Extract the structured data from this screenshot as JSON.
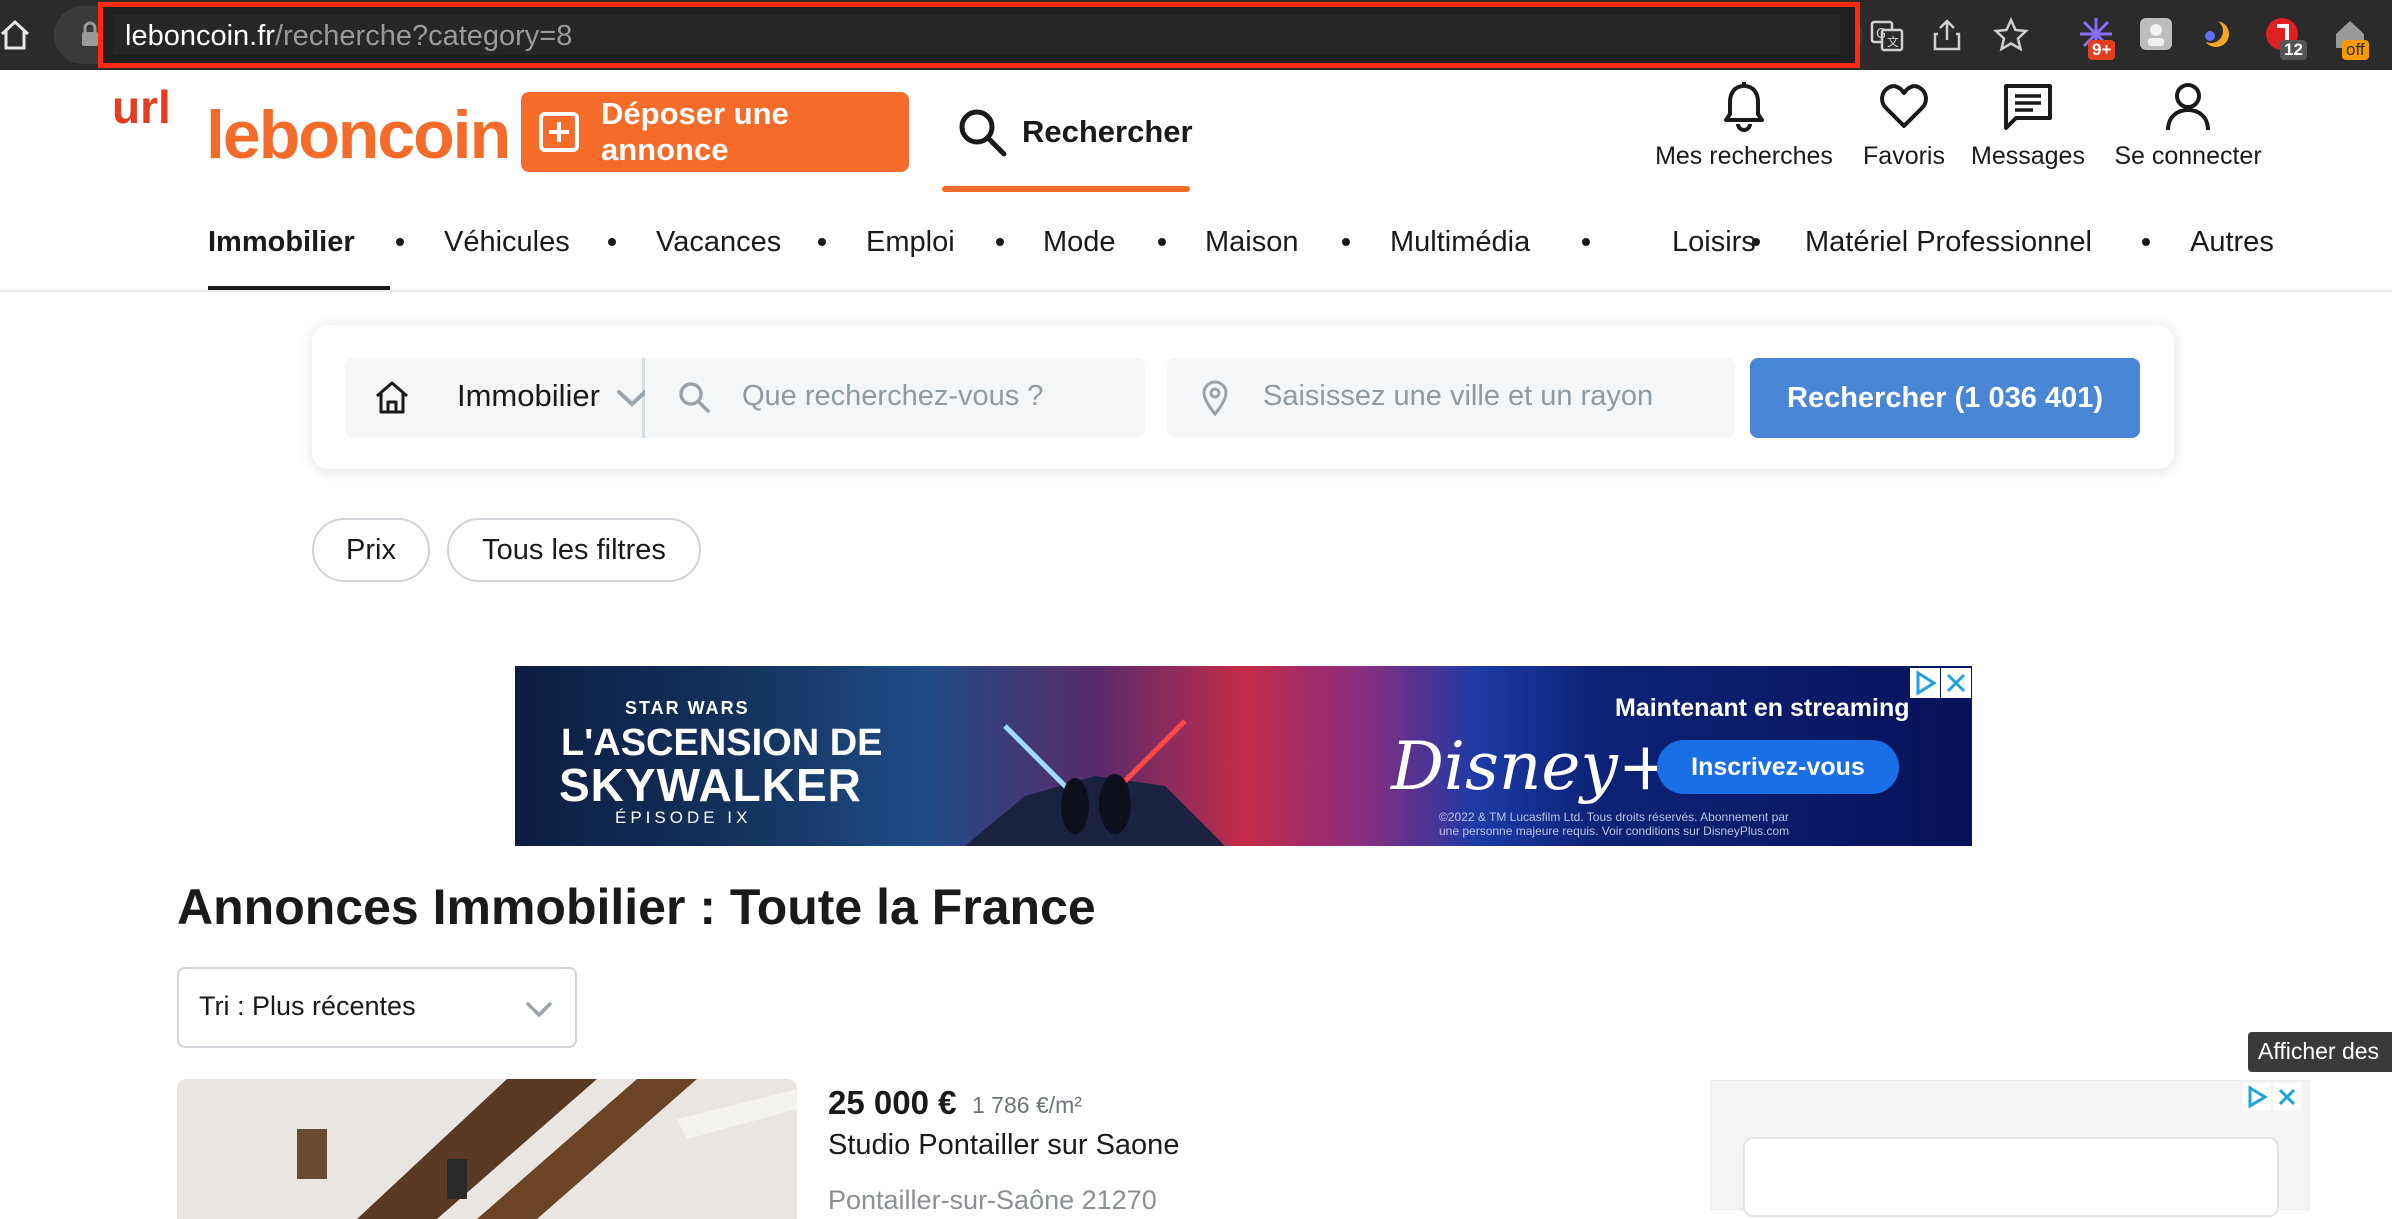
{
  "browser": {
    "url_host": "leboncoin.fr",
    "url_path": "/recherche?category=8",
    "extension_badges": [
      "9+",
      "12",
      "off"
    ]
  },
  "header": {
    "annotation": "url",
    "logo": "leboncoin",
    "post_ad_label": "Déposer une annonce",
    "search_label": "Rechercher",
    "nav": [
      "Mes recherches",
      "Favoris",
      "Messages",
      "Se connecter"
    ]
  },
  "categories": [
    "Immobilier",
    "Véhicules",
    "Vacances",
    "Emploi",
    "Mode",
    "Maison",
    "Multimédia",
    "Loisirs",
    "Matériel Professionnel",
    "Autres"
  ],
  "search": {
    "category": "Immobilier",
    "query_placeholder": "Que recherchez-vous ?",
    "location_placeholder": "Saisissez une ville et un rayon",
    "button": "Rechercher (1 036 401)"
  },
  "filters": [
    "Prix",
    "Tous les filtres"
  ],
  "banner": {
    "brand_small": "STAR WARS",
    "title_line1": "L'ASCENSION DE",
    "title_line2": "SKYWALKER",
    "episode": "ÉPISODE IX",
    "disney": "Disney+",
    "tagline": "Maintenant en streaming",
    "cta": "Inscrivez-vous",
    "legal_line1": "©2022 & TM Lucasfilm Ltd. Tous droits réservés. Abonnement par",
    "legal_line2": "une personne majeure requis. Voir conditions sur DisneyPlus.com"
  },
  "listing": {
    "page_title": "Annonces Immobilier : Toute la France",
    "sort_label": "Tri : Plus récentes",
    "items": [
      {
        "price": "25 000 €",
        "price_per_m2": "1 786 €/m²",
        "title": "Studio Pontailler sur Saone",
        "location": "Pontailler-sur-Saône 21270"
      }
    ]
  },
  "side_tooltip": "Afficher des",
  "colors": {
    "brand_orange": "#f56b2a",
    "search_blue": "#4a86d6",
    "highlight_red": "#ff2a10"
  }
}
